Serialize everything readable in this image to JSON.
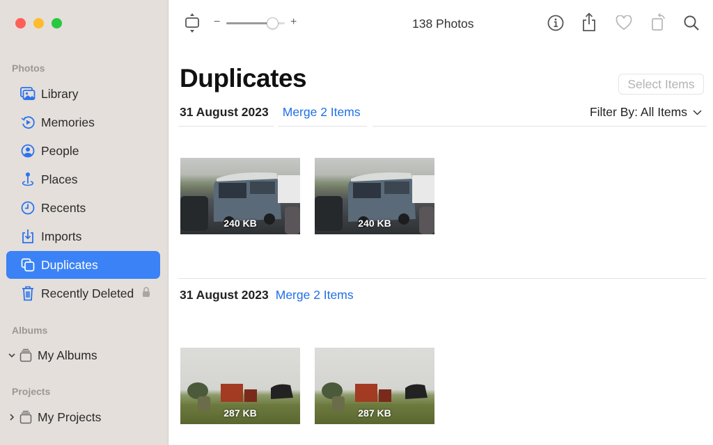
{
  "window": {
    "traffic_lights": [
      "close",
      "minimize",
      "zoom"
    ]
  },
  "sidebar": {
    "sections": [
      {
        "label": "Photos",
        "items": [
          {
            "label": "Library",
            "icon": "photo-library-icon"
          },
          {
            "label": "Memories",
            "icon": "memories-icon"
          },
          {
            "label": "People",
            "icon": "person-circle-icon"
          },
          {
            "label": "Places",
            "icon": "map-pin-icon"
          },
          {
            "label": "Recents",
            "icon": "clock-icon"
          },
          {
            "label": "Imports",
            "icon": "import-icon"
          },
          {
            "label": "Duplicates",
            "icon": "duplicate-icon",
            "selected": true
          },
          {
            "label": "Recently Deleted",
            "icon": "trash-icon",
            "locked": true
          }
        ]
      },
      {
        "label": "Albums",
        "items": [
          {
            "label": "My Albums",
            "icon": "album-stack-icon",
            "expanded": true
          }
        ]
      },
      {
        "label": "Projects",
        "items": [
          {
            "label": "My Projects",
            "icon": "album-stack-icon",
            "expanded": false
          }
        ]
      }
    ]
  },
  "toolbar": {
    "zoom_minus": "−",
    "zoom_plus": "+",
    "zoom_level": 0.78,
    "photo_count": "138 Photos",
    "icons": [
      "info-icon",
      "share-icon",
      "heart-icon",
      "rotate-icon",
      "search-icon"
    ]
  },
  "main": {
    "title": "Duplicates",
    "select_items_label": "Select Items",
    "filter_label": "Filter By:",
    "filter_value": "All Items",
    "groups": [
      {
        "date": "31 August 2023",
        "merge_label": "Merge 2 Items",
        "photos": [
          {
            "size": "240 KB",
            "subject": "van"
          },
          {
            "size": "240 KB",
            "subject": "van"
          }
        ]
      },
      {
        "date": "31 August 2023",
        "merge_label": "Merge 2 Items",
        "photos": [
          {
            "size": "287 KB",
            "subject": "farm"
          },
          {
            "size": "287 KB",
            "subject": "farm"
          }
        ]
      }
    ]
  },
  "colors": {
    "accent": "#3a82f6",
    "link": "#1f6fe5",
    "sidebar_bg": "#e4dfda"
  }
}
